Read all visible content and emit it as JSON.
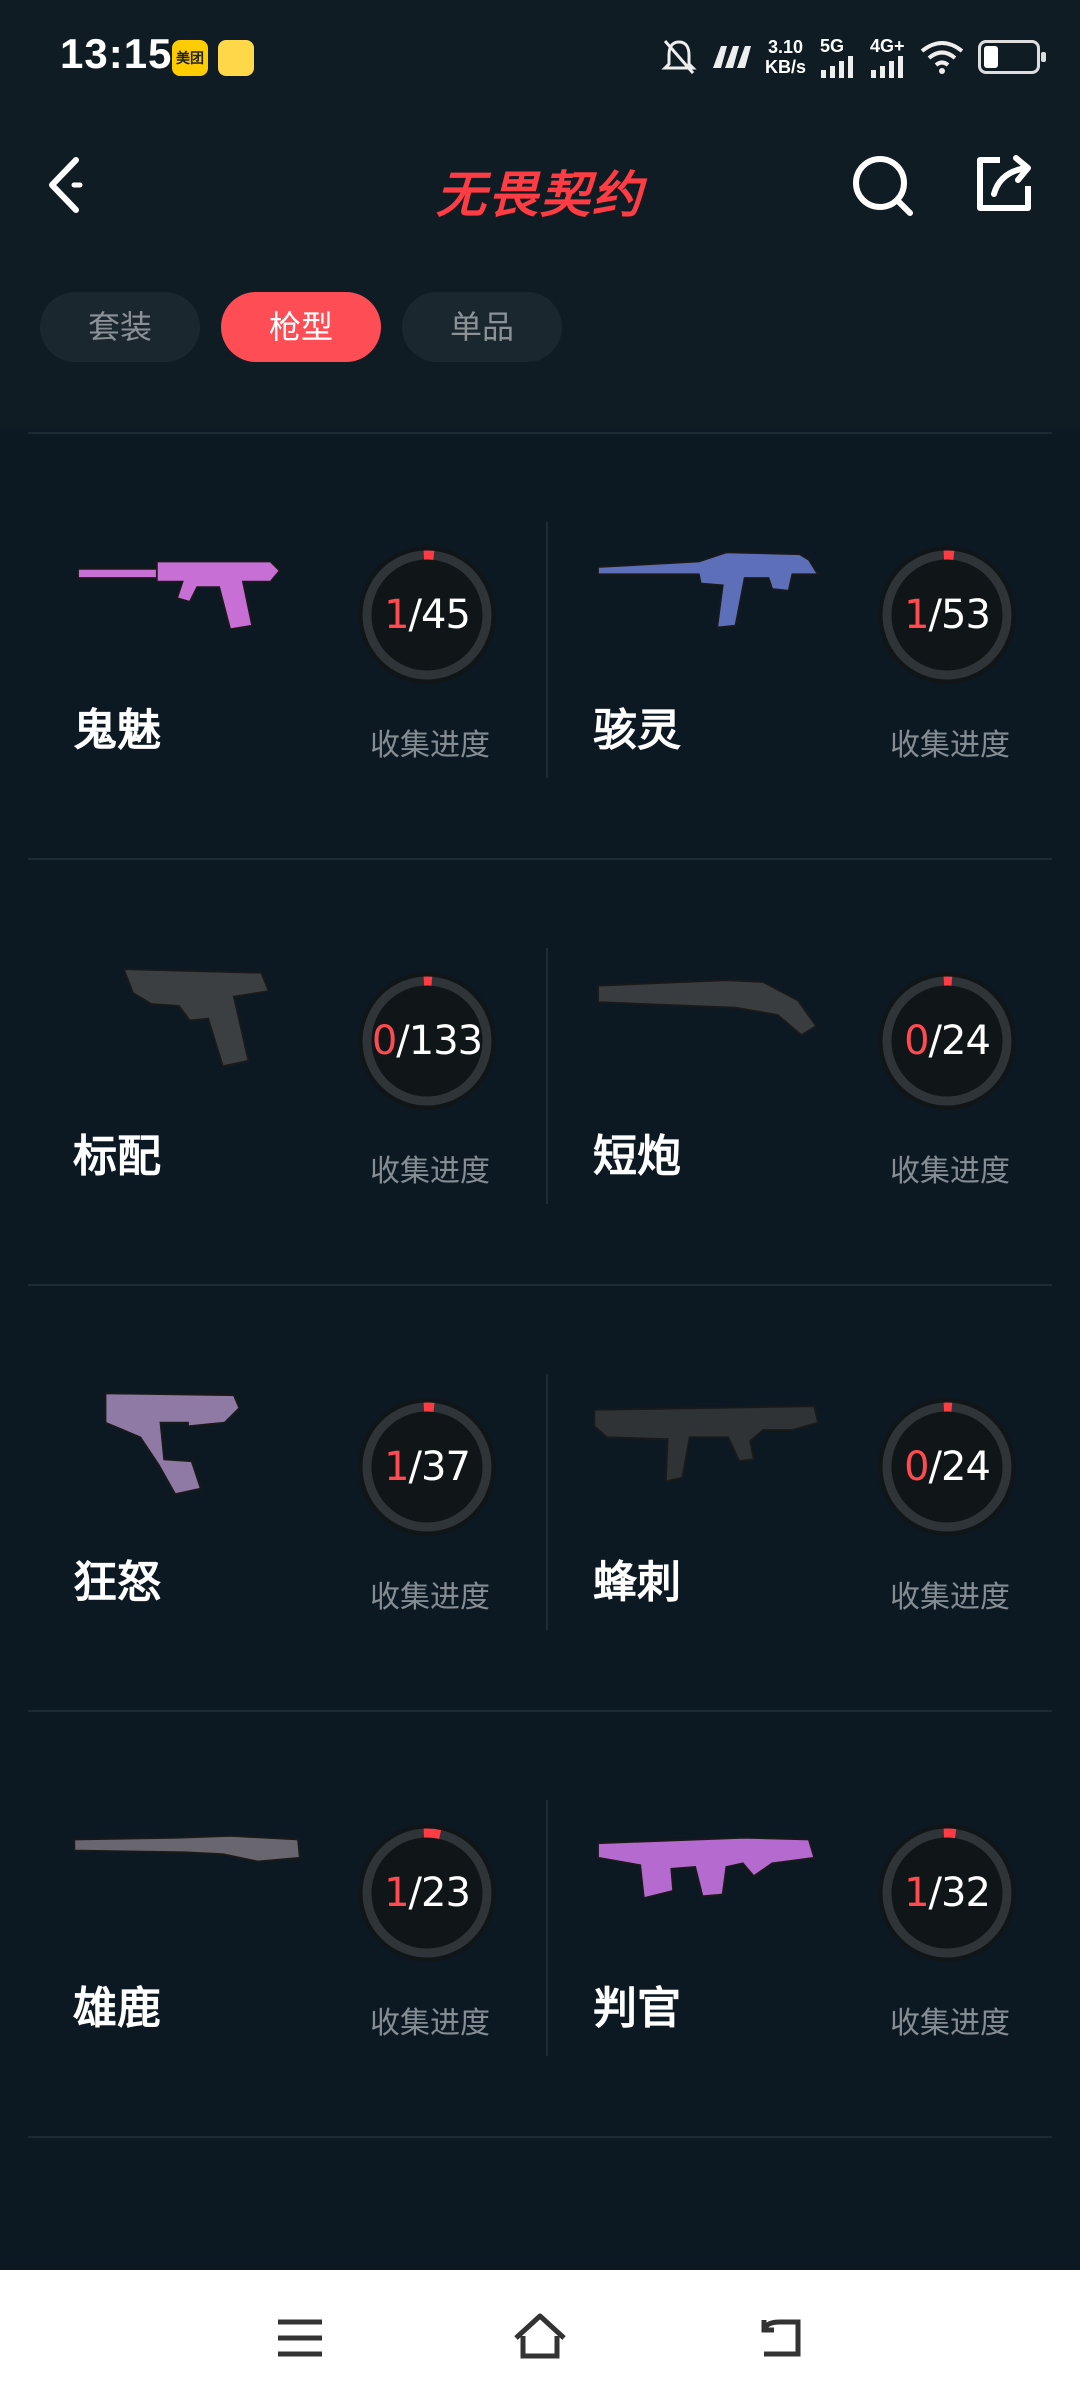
{
  "status_bar": {
    "time": "13:15",
    "app_badge_1": "美团",
    "net_speed_value": "3.10",
    "net_speed_unit": "KB/s",
    "network_1": "5G",
    "network_2": "4G+"
  },
  "header": {
    "title": "无畏契约"
  },
  "tabs": [
    {
      "label": "套装",
      "active": false
    },
    {
      "label": "枪型",
      "active": true
    },
    {
      "label": "单品",
      "active": false
    }
  ],
  "progress_label": "收集进度",
  "weapons": [
    {
      "name": "鬼魅",
      "collected": "1",
      "total": "45",
      "collected_num": 1,
      "total_num": 45,
      "icon": "ghost-pistol-icon"
    },
    {
      "name": "骇灵",
      "collected": "1",
      "total": "53",
      "collected_num": 1,
      "total_num": 53,
      "icon": "spectre-smg-icon"
    },
    {
      "name": "标配",
      "collected": "0",
      "total": "133",
      "collected_num": 0,
      "total_num": 133,
      "icon": "classic-pistol-icon"
    },
    {
      "name": "短炮",
      "collected": "0",
      "total": "24",
      "collected_num": 0,
      "total_num": 24,
      "icon": "shorty-shotgun-icon"
    },
    {
      "name": "狂怒",
      "collected": "1",
      "total": "37",
      "collected_num": 1,
      "total_num": 37,
      "icon": "frenzy-pistol-icon"
    },
    {
      "name": "蜂刺",
      "collected": "0",
      "total": "24",
      "collected_num": 0,
      "total_num": 24,
      "icon": "stinger-smg-icon"
    },
    {
      "name": "雄鹿",
      "collected": "1",
      "total": "23",
      "collected_num": 1,
      "total_num": 23,
      "icon": "bucky-shotgun-icon"
    },
    {
      "name": "判官",
      "collected": "1",
      "total": "32",
      "collected_num": 1,
      "total_num": 32,
      "icon": "judge-shotgun-icon"
    }
  ],
  "colors": {
    "accent": "#ff4d55",
    "background": "#0c1923",
    "ring_track": "#2f3438",
    "ring_progress": "#ff3b43"
  }
}
